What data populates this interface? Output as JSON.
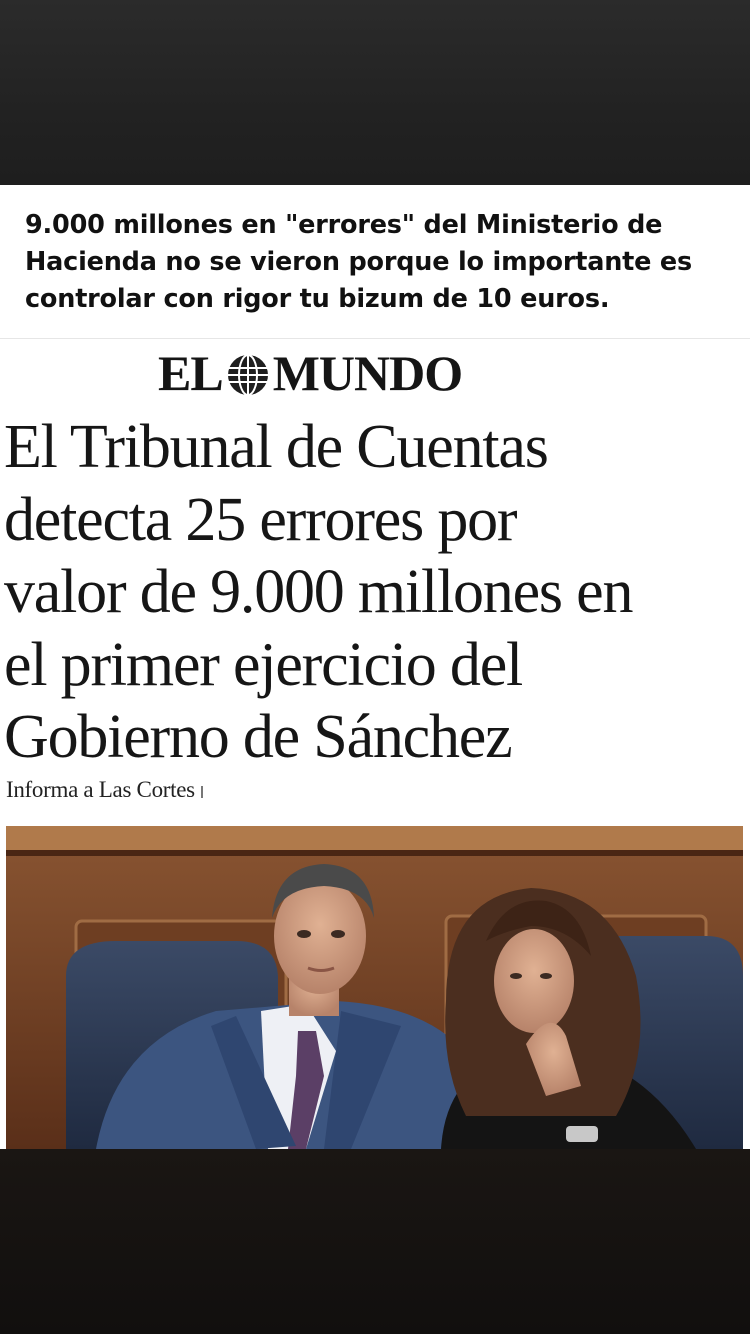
{
  "post": {
    "caption": "9.000 millones en \"errores\" del Ministerio de Hacienda no se vieron porque lo importante es controlar con rigor tu bizum de 10 euros."
  },
  "article": {
    "masthead_left": "EL",
    "masthead_right": "MUNDO",
    "headline_lines": [
      "El Tribunal de Cuentas",
      "detecta 25 errores por",
      "valor de 9.000 millones en",
      "el primer ejercicio del",
      "Gobierno de Sánchez"
    ],
    "kicker": "Informa a Las Cortes"
  },
  "icons": {
    "masthead_logo": "globe-icon"
  },
  "colors": {
    "card_background": "#ffffff",
    "text": "#111111",
    "dark_band": "#222222"
  }
}
